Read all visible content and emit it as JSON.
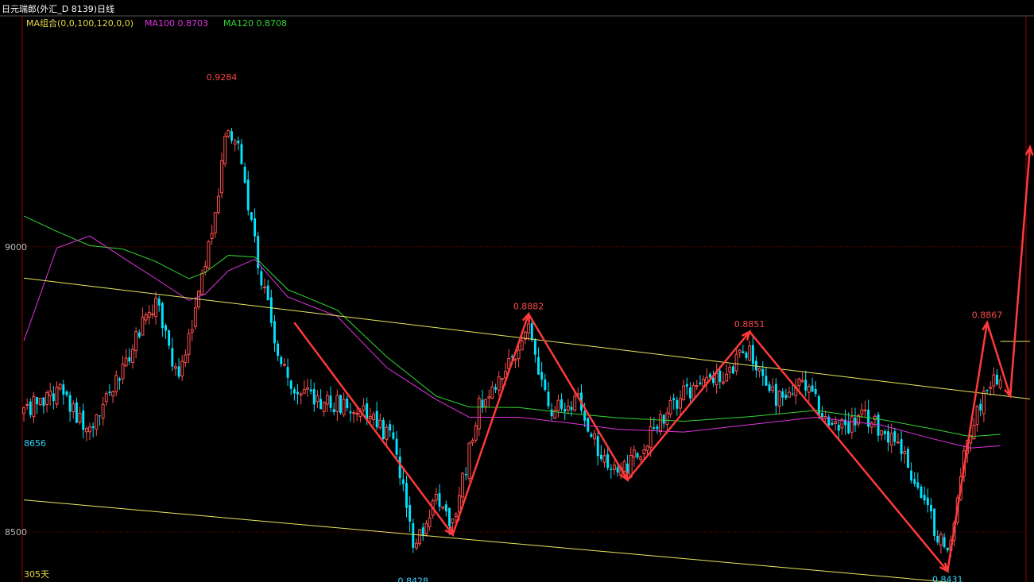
{
  "window_title": "日元瑞郎(外汇_D 8139)日线",
  "indicator": {
    "label": "MA组合(0,0,100,120,0,0)",
    "ma100_label": "MA100 0.8703",
    "ma120_label": "MA120 0.8708"
  },
  "price_labels": [
    "0.9284",
    "0.8882",
    "0.8851",
    "0.8867",
    "0.8428",
    "0.8431"
  ],
  "axis": {
    "tick_9000": "9000",
    "tick_8656": "8656",
    "tick_8500": "8500",
    "period": "305天"
  },
  "colors": {
    "background": "#000000",
    "candle_up": "#ff5050",
    "candle_down": "#00e5ff",
    "ma100": "#e033e0",
    "ma120": "#33d633",
    "channel": "#e8e860",
    "arrow": "#ff3a3a",
    "grid": "#8b0000",
    "high_label": "#ff4848",
    "low_label": "#33d6ff",
    "axis_label": "#bbbbbb"
  },
  "chart_data": {
    "type": "candlestick",
    "instrument": "日元瑞郎",
    "ylim": [
      0.8412,
      0.9405
    ],
    "bar_count": 305,
    "grid_levels": [
      0.9,
      0.85
    ],
    "ma100_last": 0.8703,
    "ma120_last": 0.8708,
    "swing_points": [
      {
        "bar": 82,
        "price": 0.8867
      },
      {
        "bar": 130,
        "price": 0.8495
      },
      {
        "bar": 153,
        "price": 0.8882
      },
      {
        "bar": 183,
        "price": 0.8591
      },
      {
        "bar": 220,
        "price": 0.8851
      },
      {
        "bar": 280,
        "price": 0.8431
      },
      {
        "bar": 292,
        "price": 0.8867
      },
      {
        "bar": 299,
        "price": 0.8738
      },
      {
        "bar": 305,
        "price": 0.9175
      }
    ],
    "annotations": [
      {
        "text": "0.9284",
        "bar": 60,
        "price": 0.9284,
        "kind": "high"
      },
      {
        "text": "0.8882",
        "bar": 153,
        "price": 0.8882,
        "kind": "high"
      },
      {
        "text": "0.8851",
        "bar": 220,
        "price": 0.8851,
        "kind": "high"
      },
      {
        "text": "0.8867",
        "bar": 292,
        "price": 0.8867,
        "kind": "high"
      },
      {
        "text": "0.8428",
        "bar": 118,
        "price": 0.8428,
        "kind": "low"
      },
      {
        "text": "0.8431",
        "bar": 280,
        "price": 0.8431,
        "kind": "low"
      }
    ],
    "channel_upper": [
      {
        "bar": 0,
        "price": 0.8945
      },
      {
        "bar": 305,
        "price": 0.8733
      }
    ],
    "channel_lower": [
      {
        "bar": 0,
        "price": 0.8556
      },
      {
        "bar": 305,
        "price": 0.8399
      }
    ],
    "close_path": [
      {
        "bar": 0,
        "price": 0.871
      },
      {
        "bar": 10,
        "price": 0.875
      },
      {
        "bar": 20,
        "price": 0.868
      },
      {
        "bar": 30,
        "price": 0.879
      },
      {
        "bar": 40,
        "price": 0.891
      },
      {
        "bar": 47,
        "price": 0.876
      },
      {
        "bar": 52,
        "price": 0.889
      },
      {
        "bar": 58,
        "price": 0.905
      },
      {
        "bar": 62,
        "price": 0.922
      },
      {
        "bar": 66,
        "price": 0.915
      },
      {
        "bar": 72,
        "price": 0.894
      },
      {
        "bar": 78,
        "price": 0.879
      },
      {
        "bar": 82,
        "price": 0.874
      },
      {
        "bar": 92,
        "price": 0.873
      },
      {
        "bar": 102,
        "price": 0.871
      },
      {
        "bar": 112,
        "price": 0.866
      },
      {
        "bar": 118,
        "price": 0.848
      },
      {
        "bar": 125,
        "price": 0.855
      },
      {
        "bar": 130,
        "price": 0.851
      },
      {
        "bar": 138,
        "price": 0.872
      },
      {
        "bar": 146,
        "price": 0.878
      },
      {
        "bar": 153,
        "price": 0.885
      },
      {
        "bar": 160,
        "price": 0.871
      },
      {
        "bar": 168,
        "price": 0.873
      },
      {
        "bar": 176,
        "price": 0.862
      },
      {
        "bar": 183,
        "price": 0.861
      },
      {
        "bar": 192,
        "price": 0.869
      },
      {
        "bar": 200,
        "price": 0.874
      },
      {
        "bar": 210,
        "price": 0.877
      },
      {
        "bar": 220,
        "price": 0.882
      },
      {
        "bar": 228,
        "price": 0.873
      },
      {
        "bar": 236,
        "price": 0.876
      },
      {
        "bar": 245,
        "price": 0.868
      },
      {
        "bar": 255,
        "price": 0.87
      },
      {
        "bar": 265,
        "price": 0.866
      },
      {
        "bar": 272,
        "price": 0.856
      },
      {
        "bar": 280,
        "price": 0.846
      },
      {
        "bar": 286,
        "price": 0.866
      },
      {
        "bar": 292,
        "price": 0.876
      },
      {
        "bar": 296,
        "price": 0.878
      }
    ],
    "ma100": [
      {
        "bar": 0,
        "price": 0.8835
      },
      {
        "bar": 10,
        "price": 0.8998
      },
      {
        "bar": 20,
        "price": 0.9019
      },
      {
        "bar": 30,
        "price": 0.8981
      },
      {
        "bar": 40,
        "price": 0.8944
      },
      {
        "bar": 50,
        "price": 0.8906
      },
      {
        "bar": 55,
        "price": 0.8917
      },
      {
        "bar": 62,
        "price": 0.8958
      },
      {
        "bar": 70,
        "price": 0.8978
      },
      {
        "bar": 80,
        "price": 0.8912
      },
      {
        "bar": 95,
        "price": 0.8878
      },
      {
        "bar": 110,
        "price": 0.8788
      },
      {
        "bar": 125,
        "price": 0.8732
      },
      {
        "bar": 135,
        "price": 0.8701
      },
      {
        "bar": 150,
        "price": 0.8701
      },
      {
        "bar": 165,
        "price": 0.8691
      },
      {
        "bar": 180,
        "price": 0.868
      },
      {
        "bar": 200,
        "price": 0.8675
      },
      {
        "bar": 220,
        "price": 0.8688
      },
      {
        "bar": 240,
        "price": 0.8701
      },
      {
        "bar": 260,
        "price": 0.8687
      },
      {
        "bar": 275,
        "price": 0.8664
      },
      {
        "bar": 287,
        "price": 0.8647
      },
      {
        "bar": 296,
        "price": 0.8651
      }
    ],
    "ma120": [
      {
        "bar": 0,
        "price": 0.9054
      },
      {
        "bar": 10,
        "price": 0.9027
      },
      {
        "bar": 20,
        "price": 0.9002
      },
      {
        "bar": 30,
        "price": 0.8996
      },
      {
        "bar": 40,
        "price": 0.8974
      },
      {
        "bar": 50,
        "price": 0.8944
      },
      {
        "bar": 55,
        "price": 0.8955
      },
      {
        "bar": 62,
        "price": 0.8985
      },
      {
        "bar": 70,
        "price": 0.8982
      },
      {
        "bar": 80,
        "price": 0.8925
      },
      {
        "bar": 95,
        "price": 0.8889
      },
      {
        "bar": 110,
        "price": 0.8807
      },
      {
        "bar": 125,
        "price": 0.8738
      },
      {
        "bar": 135,
        "price": 0.8719
      },
      {
        "bar": 150,
        "price": 0.8718
      },
      {
        "bar": 165,
        "price": 0.8708
      },
      {
        "bar": 180,
        "price": 0.87
      },
      {
        "bar": 200,
        "price": 0.8694
      },
      {
        "bar": 220,
        "price": 0.8702
      },
      {
        "bar": 240,
        "price": 0.8713
      },
      {
        "bar": 260,
        "price": 0.8697
      },
      {
        "bar": 275,
        "price": 0.8681
      },
      {
        "bar": 287,
        "price": 0.8667
      },
      {
        "bar": 296,
        "price": 0.8671
      }
    ]
  }
}
